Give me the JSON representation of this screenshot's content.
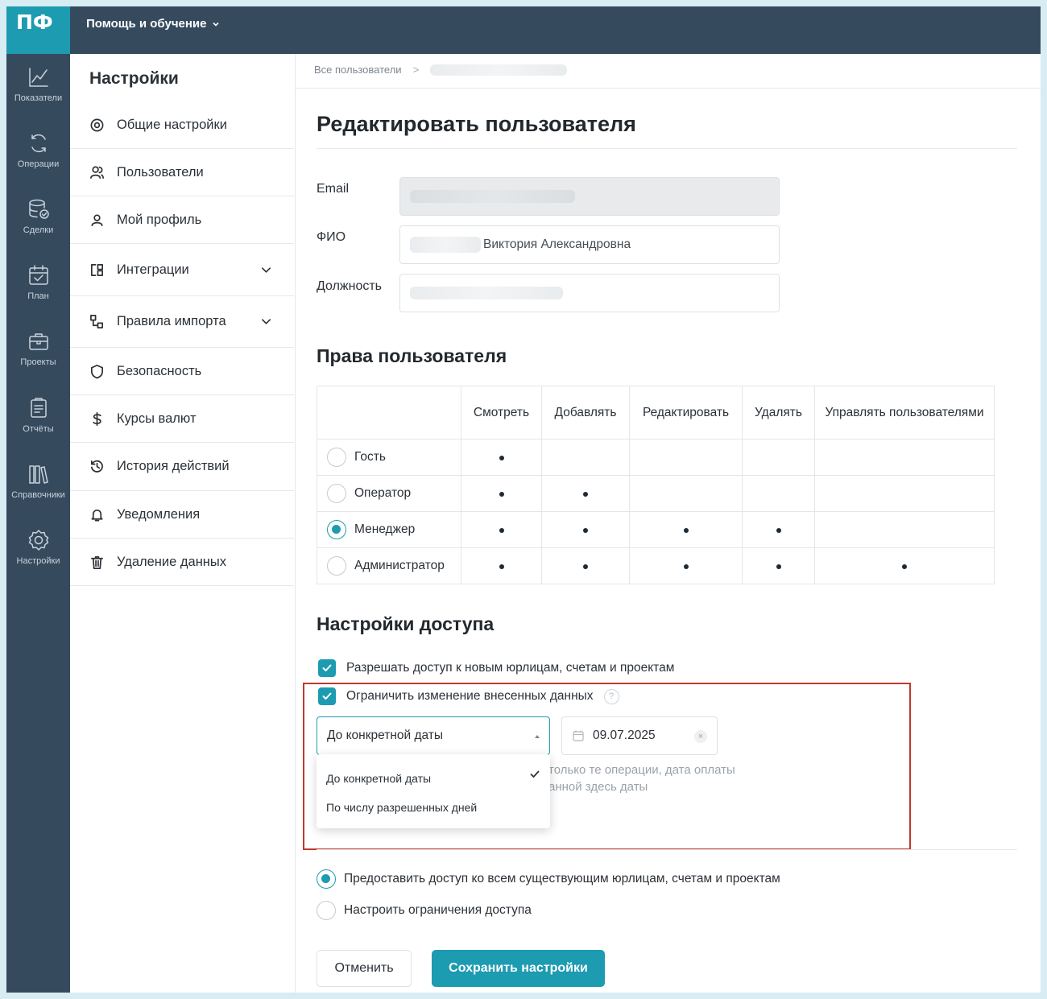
{
  "app": {
    "logo": "ПФ",
    "help_menu": "Помощь и обучение"
  },
  "rail": [
    {
      "label": "Показатели",
      "icon": "chart-line-icon"
    },
    {
      "label": "Операции",
      "icon": "refresh-icon"
    },
    {
      "label": "Сделки",
      "icon": "database-check-icon"
    },
    {
      "label": "План",
      "icon": "calendar-check-icon"
    },
    {
      "label": "Проекты",
      "icon": "briefcase-icon"
    },
    {
      "label": "Отчёты",
      "icon": "clipboard-icon"
    },
    {
      "label": "Справочники",
      "icon": "books-icon"
    },
    {
      "label": "Настройки",
      "icon": "gear-icon"
    }
  ],
  "sidebar": {
    "title": "Настройки",
    "items": [
      {
        "label": "Общие настройки",
        "icon": "settings-icon"
      },
      {
        "label": "Пользователи",
        "icon": "users-icon"
      },
      {
        "label": "Мой профиль",
        "icon": "user-icon"
      },
      {
        "label": "Интеграции",
        "icon": "integrations-icon",
        "expandable": true
      },
      {
        "label": "Правила импорта",
        "icon": "import-rules-icon",
        "expandable": true
      },
      {
        "label": "Безопасность",
        "icon": "shield-icon"
      },
      {
        "label": "Курсы валют",
        "icon": "dollar-icon"
      },
      {
        "label": "История действий",
        "icon": "history-icon"
      },
      {
        "label": "Уведомления",
        "icon": "bell-icon"
      },
      {
        "label": "Удаление данных",
        "icon": "trash-icon"
      }
    ]
  },
  "breadcrumb": {
    "root": "Все пользователи",
    "separator": ">"
  },
  "page": {
    "title": "Редактировать пользователя"
  },
  "form": {
    "email_label": "Email",
    "name_label": "ФИО",
    "name_value": "Виктория Александровна",
    "position_label": "Должность"
  },
  "rights": {
    "title": "Права пользователя",
    "columns": [
      "Смотреть",
      "Добавлять",
      "Редактировать",
      "Удалять",
      "Управлять пользователями"
    ],
    "roles": [
      {
        "name": "Гость",
        "selected": false,
        "perms": [
          true,
          false,
          false,
          false,
          false
        ]
      },
      {
        "name": "Оператор",
        "selected": false,
        "perms": [
          true,
          true,
          false,
          false,
          false
        ]
      },
      {
        "name": "Менеджер",
        "selected": true,
        "perms": [
          true,
          true,
          true,
          true,
          false
        ]
      },
      {
        "name": "Администратор",
        "selected": false,
        "perms": [
          true,
          true,
          true,
          true,
          true
        ]
      }
    ]
  },
  "access": {
    "title": "Настройки доступа",
    "allow_new_label": "Разрешать доступ к новым юрлицам, счетам и проектам",
    "allow_new_checked": true,
    "restrict_label": "Ограничить изменение внесенных данных",
    "restrict_checked": true,
    "help_mark": "?",
    "mode_selected": "До конкретной даты",
    "date_value": "09.07.2025",
    "clear_mark": "×",
    "hint_line1": "только те операции, дата оплаты",
    "hint_line2": "анной здесь даты",
    "options": [
      {
        "label": "До конкретной даты",
        "checked": true
      },
      {
        "label": "По числу разрешенных дней",
        "checked": false
      }
    ],
    "grant_all_label": "Предоставить доступ ко всем существующим юрлицам, счетам и проектам",
    "grant_all_selected": true,
    "custom_label": "Настроить ограничения доступа",
    "custom_selected": false
  },
  "buttons": {
    "cancel": "Отменить",
    "save": "Сохранить настройки"
  },
  "colors": {
    "accent": "#1c9bb1",
    "nav": "#364a5e",
    "highlight": "#c0392b"
  }
}
